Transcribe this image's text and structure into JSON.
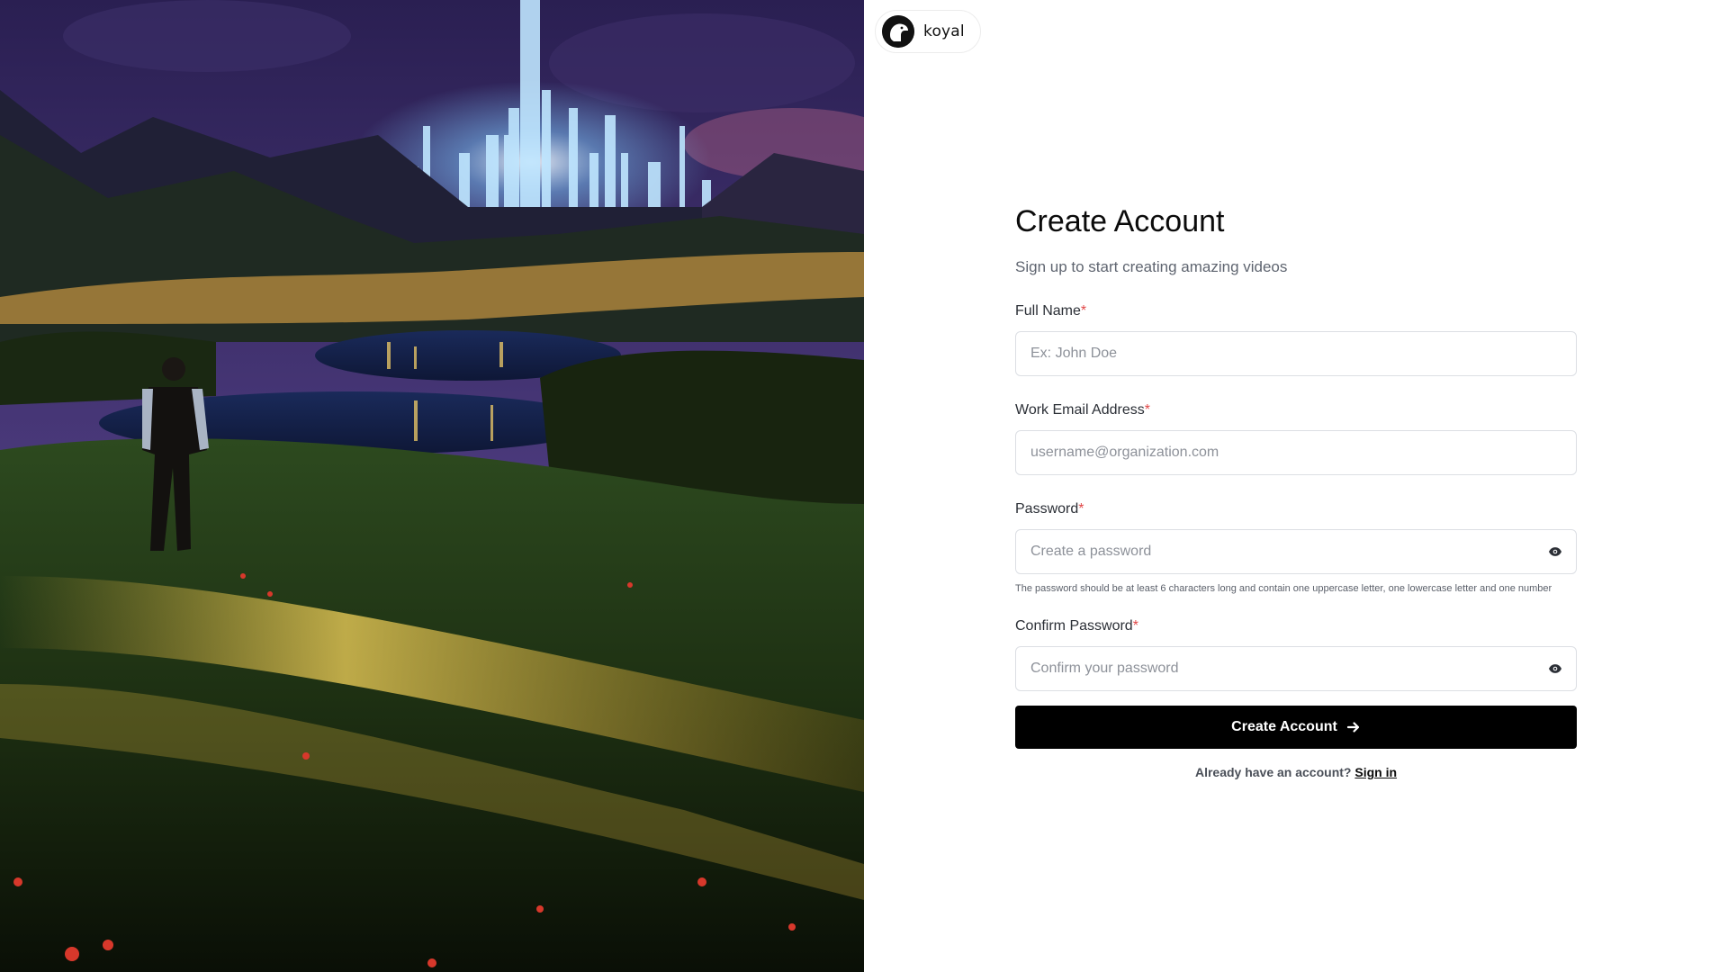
{
  "brand": {
    "name": "koyal",
    "logo_icon": "bird-head-icon"
  },
  "hero": {
    "image": "night-landscape-city-illustration"
  },
  "form": {
    "title": "Create Account",
    "subtitle": "Sign up to start creating amazing videos",
    "fields": [
      {
        "label": "Full Name",
        "required_mark": "*",
        "placeholder": "Ex: John Doe",
        "value": ""
      },
      {
        "label": "Work Email Address",
        "required_mark": "*",
        "placeholder": "username@organization.com",
        "value": ""
      },
      {
        "label": "Password",
        "required_mark": "*",
        "placeholder": "Create a password",
        "value": "",
        "toggle_icon": "eye-icon",
        "hint": "The password should be at least 6 characters long and contain one uppercase letter, one lowercase letter and one number"
      },
      {
        "label": "Confirm Password",
        "required_mark": "*",
        "placeholder": "Confirm your password",
        "value": "",
        "toggle_icon": "eye-icon"
      }
    ],
    "submit_label": "Create Account",
    "submit_icon": "arrow-right-icon",
    "signin_prompt": "Already have an account?",
    "signin_link": "Sign in"
  },
  "colors": {
    "accent": "#000000",
    "required": "#e14848",
    "border": "#dcdfe4"
  }
}
